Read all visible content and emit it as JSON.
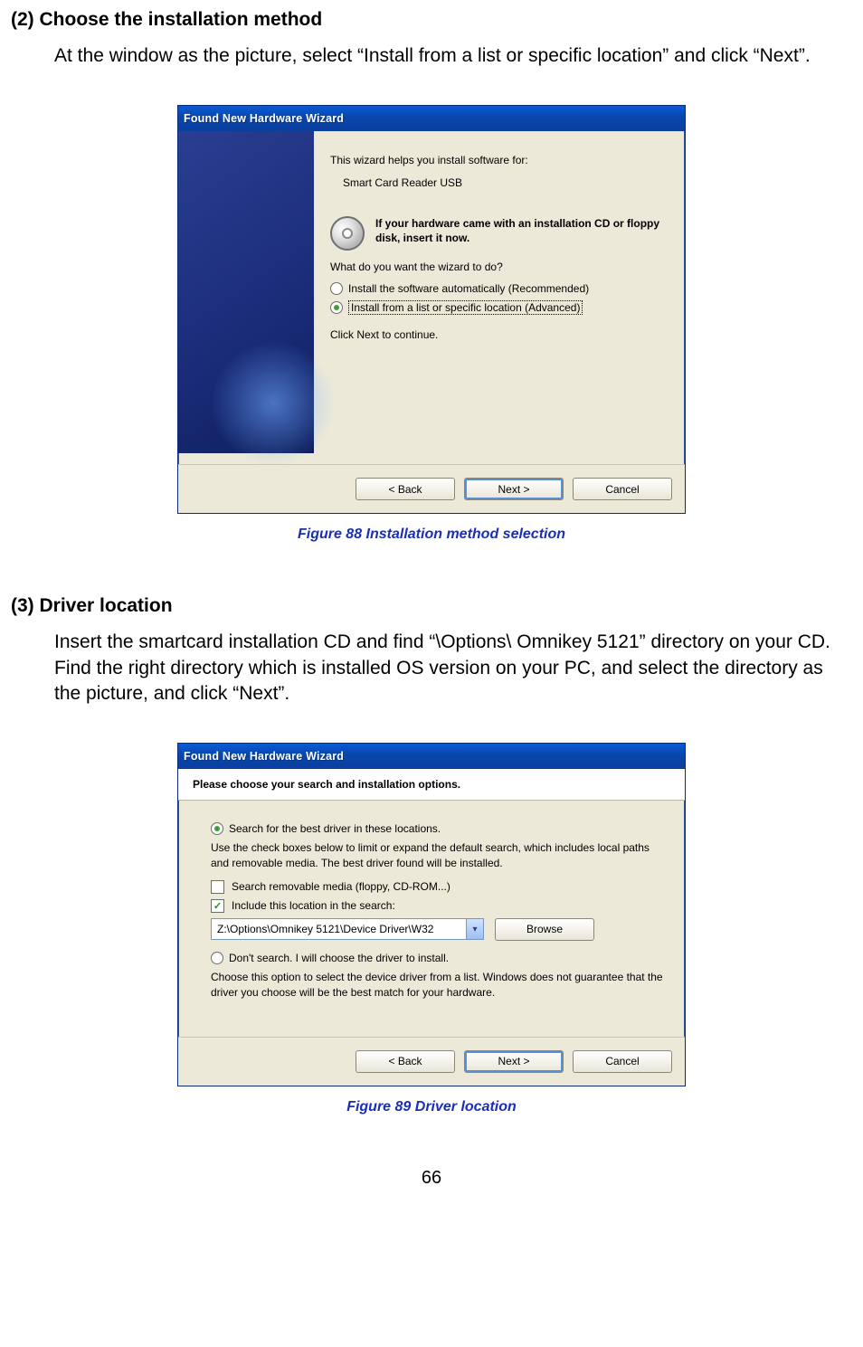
{
  "sections": {
    "s2": {
      "title": "(2) Choose the installation method",
      "body": "At the window as the picture, select “Install from a list or specific location” and click “Next”."
    },
    "s3": {
      "title": "(3) Driver location",
      "body": "Insert the smartcard installation CD and find “\\Options\\ Omnikey 5121” directory on your CD. Find the right directory which is installed OS version on your PC, and select the directory as the picture, and click “Next”."
    }
  },
  "captions": {
    "fig88": "Figure 88 Installation method selection",
    "fig89": "Figure 89 Driver location"
  },
  "dialog1": {
    "title": "Found New Hardware Wizard",
    "intro": "This wizard helps you install software for:",
    "device": "Smart Card Reader USB",
    "insert_cd": "If your hardware came with an installation CD or floppy disk, insert it now.",
    "question": "What do you want the wizard to do?",
    "opt_auto_pre": "Install the software automatically (Recommended)",
    "opt_list_pre": "Install from a list or specific location (Advanced)",
    "continue": "Click Next to continue.",
    "buttons": {
      "back": "< Back",
      "next": "Next >",
      "cancel": "Cancel"
    }
  },
  "dialog2": {
    "title": "Found New Hardware Wizard",
    "subhead": "Please choose your search and installation options.",
    "opt_search": "Search for the best driver in these locations.",
    "search_help": "Use the check boxes below to limit or expand the default search, which includes local paths and removable media. The best driver found will be installed.",
    "chk_removable": "Search removable media (floppy, CD-ROM...)",
    "chk_include": "Include this location in the search:",
    "path": "Z:\\Options\\Omnikey 5121\\Device Driver\\W32",
    "browse": "Browse",
    "opt_dont": "Don't search. I will choose the driver to install.",
    "dont_help": "Choose this option to select the device driver from a list.  Windows does not guarantee that the driver you choose will be the best match for your hardware.",
    "buttons": {
      "back": "< Back",
      "next": "Next >",
      "cancel": "Cancel"
    }
  },
  "page_number": "66"
}
